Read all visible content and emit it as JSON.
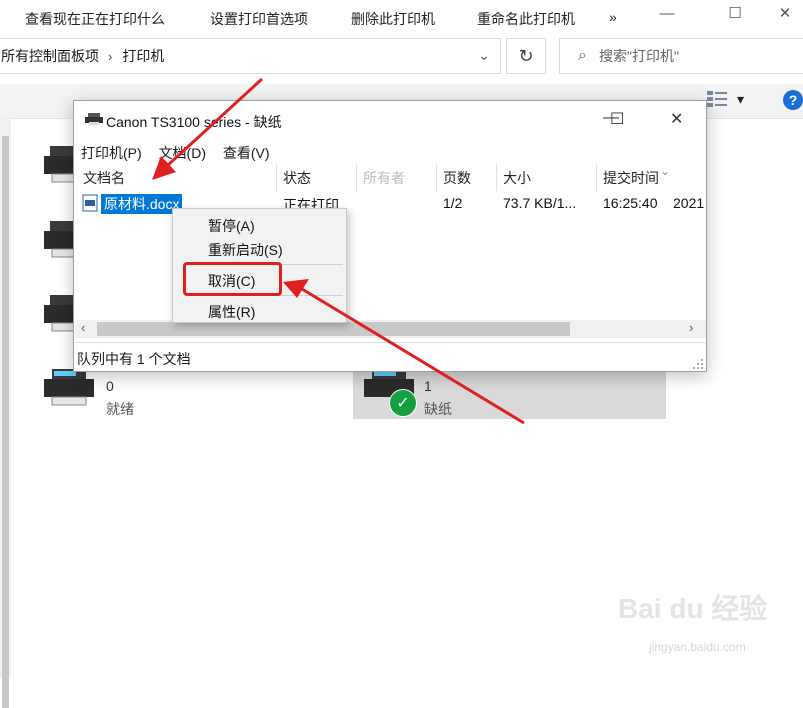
{
  "window": {
    "min_glyph": "—",
    "max_glyph": "☐",
    "close_glyph": "✕"
  },
  "address": {
    "crumb1": "所有控制面板项",
    "sep": "›",
    "crumb2": "打印机",
    "dropdown_glyph": "⌄"
  },
  "refresh_glyph": "↻",
  "search": {
    "placeholder": "搜索\"打印机\"",
    "icon_glyph": "⌕"
  },
  "toolbar": {
    "items": [
      "查看现在正在打印什么",
      "设置打印首选项",
      "删除此打印机",
      "重命名此打印机"
    ],
    "more": "»",
    "view_dropdown": "▾",
    "help": "?"
  },
  "printers": [
    {
      "count": "0",
      "status": "就绪"
    },
    {
      "count": "1",
      "status": "缺纸"
    }
  ],
  "default_check": "✓",
  "dialog": {
    "title": "Canon TS3100 series - 缺纸",
    "min_glyph": "—",
    "max_glyph": "☐",
    "close_glyph": "✕",
    "menu": [
      "打印机(P)",
      "文档(D)",
      "查看(V)"
    ],
    "columns": [
      "文档名",
      "状态",
      "所有者",
      "页数",
      "大小",
      "提交时间"
    ],
    "sort_glyph": "⌄",
    "row": {
      "name": "原材料.docx",
      "status": "正在打印",
      "pages": "1/2",
      "size": "73.7 KB/1...",
      "time": "16:25:40",
      "date": "2021"
    },
    "scroll_left": "‹",
    "scroll_right": "›",
    "status_text": "队列中有 1 个文档"
  },
  "context_menu": {
    "items": [
      "暂停(A)",
      "重新启动(S)",
      "取消(C)",
      "属性(R)"
    ]
  },
  "annotation_color": "#e02020",
  "watermark": {
    "brand": "Bai du 经验",
    "url": "jingyan.baidu.com"
  }
}
